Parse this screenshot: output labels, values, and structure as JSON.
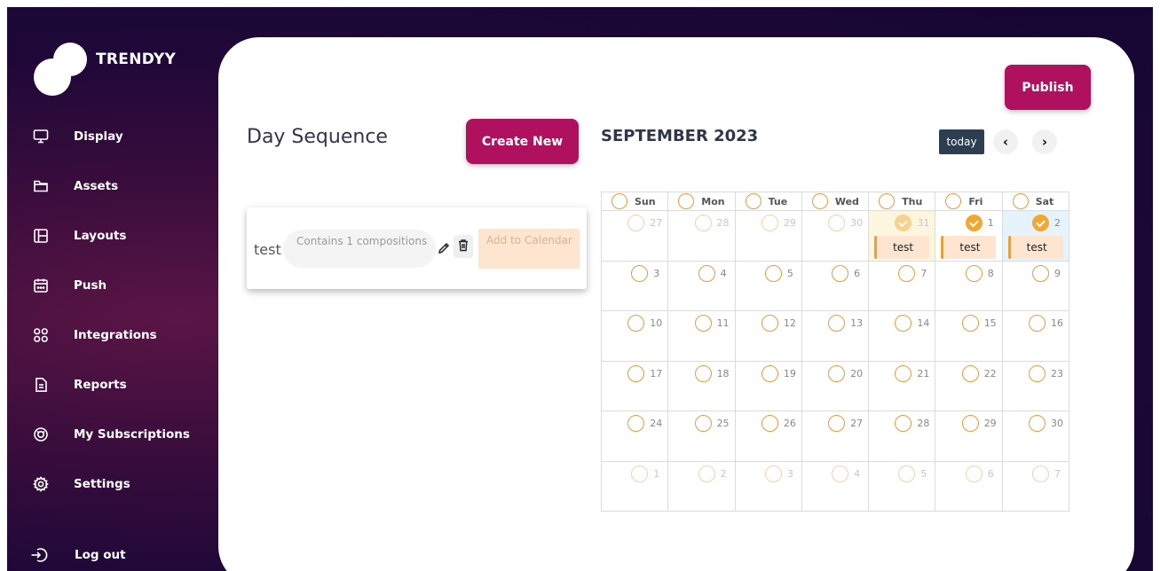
{
  "brand": {
    "name": "TRENDYY"
  },
  "sidebar": {
    "items": [
      {
        "label": "Display",
        "icon": "monitor-icon"
      },
      {
        "label": "Assets",
        "icon": "folder-icon"
      },
      {
        "label": "Layouts",
        "icon": "layout-icon"
      },
      {
        "label": "Push",
        "icon": "calendar-push-icon"
      },
      {
        "label": "Integrations",
        "icon": "grid-icon"
      },
      {
        "label": "Reports",
        "icon": "document-icon"
      },
      {
        "label": "My Subscriptions",
        "icon": "subscription-icon"
      },
      {
        "label": "Settings",
        "icon": "gear-icon"
      }
    ],
    "logout": {
      "label": "Log out",
      "icon": "logout-icon"
    }
  },
  "header": {
    "publish_label": "Publish"
  },
  "day_sequence": {
    "title": "Day Sequence",
    "create_label": "Create New",
    "items": [
      {
        "name": "test",
        "summary": "Contains 1 compositions",
        "add_label": "Add to Calendar"
      }
    ]
  },
  "calendar": {
    "month_title": "SEPTEMBER 2023",
    "today_label": "today",
    "prev_glyph": "‹",
    "next_glyph": "›",
    "weekdays": [
      "Sun",
      "Mon",
      "Tue",
      "Wed",
      "Thu",
      "Fri",
      "Sat"
    ],
    "weeks": [
      [
        {
          "day": "27",
          "faded": true,
          "checked": false
        },
        {
          "day": "28",
          "faded": true,
          "checked": false
        },
        {
          "day": "29",
          "faded": true,
          "checked": false
        },
        {
          "day": "30",
          "faded": true,
          "checked": false
        },
        {
          "day": "31",
          "faded": true,
          "checked": true,
          "event": "test",
          "highlight": "today"
        },
        {
          "day": "1",
          "faded": false,
          "checked": true,
          "event": "test"
        },
        {
          "day": "2",
          "faded": false,
          "checked": true,
          "event": "test",
          "highlight": "selected"
        }
      ],
      [
        {
          "day": "3"
        },
        {
          "day": "4"
        },
        {
          "day": "5"
        },
        {
          "day": "6"
        },
        {
          "day": "7"
        },
        {
          "day": "8"
        },
        {
          "day": "9"
        }
      ],
      [
        {
          "day": "10"
        },
        {
          "day": "11"
        },
        {
          "day": "12"
        },
        {
          "day": "13"
        },
        {
          "day": "14"
        },
        {
          "day": "15"
        },
        {
          "day": "16"
        }
      ],
      [
        {
          "day": "17"
        },
        {
          "day": "18"
        },
        {
          "day": "19"
        },
        {
          "day": "20"
        },
        {
          "day": "21"
        },
        {
          "day": "22"
        },
        {
          "day": "23"
        }
      ],
      [
        {
          "day": "24"
        },
        {
          "day": "25"
        },
        {
          "day": "26"
        },
        {
          "day": "27"
        },
        {
          "day": "28"
        },
        {
          "day": "29"
        },
        {
          "day": "30"
        }
      ],
      [
        {
          "day": "1",
          "faded": true
        },
        {
          "day": "2",
          "faded": true
        },
        {
          "day": "3",
          "faded": true
        },
        {
          "day": "4",
          "faded": true
        },
        {
          "day": "5",
          "faded": true
        },
        {
          "day": "6",
          "faded": true
        },
        {
          "day": "7",
          "faded": true
        }
      ]
    ]
  },
  "colors": {
    "accent": "#b0115f",
    "sidebar_bg": "#1e0838",
    "check": "#f0a832",
    "event_bg": "#fde5cf",
    "today_btn": "#2c3e50"
  }
}
